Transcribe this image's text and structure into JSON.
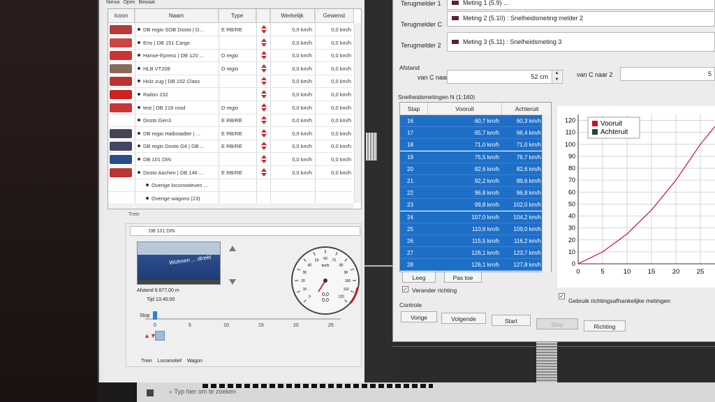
{
  "menu": [
    "Nieuw",
    "Open",
    "Bewaar"
  ],
  "loco_table": {
    "headers": {
      "icon": "Icoon",
      "name": "Naam",
      "type": "Type",
      "actual": "Werkelijk",
      "desired": "Gewenst"
    },
    "rows": [
      {
        "name": "DB regio SOB Dosto | D...",
        "type": "E RB/RE",
        "actual": "0,0 km/h",
        "desired": "0,0 km/h",
        "color": "#b83a3a"
      },
      {
        "name": "Erts | DB 151 Cargo",
        "type": "",
        "actual": "0,0 km/h",
        "desired": "0,0 km/h",
        "color": "#c44"
      },
      {
        "name": "Hanse-Epress | DB 120 ...",
        "type": "D regio",
        "actual": "0,0 km/h",
        "desired": "0,0 km/h",
        "color": "#c33"
      },
      {
        "name": "HLB VT208",
        "type": "D regio",
        "actual": "0,0 km/h",
        "desired": "0,0 km/h",
        "color": "#8a6a5a"
      },
      {
        "name": "Holz zug | DB 152 Class",
        "type": "",
        "actual": "0,0 km/h",
        "desired": "0,0 km/h",
        "color": "#b33"
      },
      {
        "name": "Railon 232",
        "type": "",
        "actual": "0,0 km/h",
        "desired": "0,0 km/h",
        "color": "#c22"
      },
      {
        "name": "test | DB 218 rood",
        "type": "D regio",
        "actual": "0,0 km/h",
        "desired": "0,0 km/h",
        "color": "#c33"
      },
      {
        "name": "Dosto Gen3",
        "type": "E RB/RE",
        "actual": "0,0 km/h",
        "desired": "0,0 km/h",
        "color": ""
      },
      {
        "name": "DB regio Halbstadter | ...",
        "type": "E RB/RE",
        "actual": "0,0 km/h",
        "desired": "0,0 km/h",
        "color": "#445"
      },
      {
        "name": "DB regio Dosto G4 | DB ...",
        "type": "E RB/RE",
        "actual": "0,0 km/h",
        "desired": "0,0 km/h",
        "color": "#446"
      },
      {
        "name": "DB 101 DIN",
        "type": "",
        "actual": "0,0 km/h",
        "desired": "0,0 km/h",
        "color": "#2a4c8c"
      },
      {
        "name": "Dosto Aachen | DB 146 ...",
        "type": "E RB/RE",
        "actual": "0,0 km/h",
        "desired": "0,0 km/h",
        "color": "#b33"
      },
      {
        "name": "Overige locomotieven ...",
        "type": "",
        "actual": "",
        "desired": "",
        "color": ""
      },
      {
        "name": "Overige wagons (23)",
        "type": "",
        "actual": "",
        "desired": "",
        "color": ""
      }
    ]
  },
  "trein": {
    "section_label": "Trein",
    "selected": "DB 101 DIN",
    "photo_text": "Wohnen ... direkt",
    "distance_label": "Afstand",
    "distance_value": "6.677,00 m",
    "time_label": "Tijd",
    "time_value": "13:45:00",
    "stop_label": "Stop",
    "slider_ticks": [
      "0",
      "5",
      "10",
      "15",
      "20",
      "25"
    ],
    "tabs": [
      "Trein",
      "Locomotief",
      "Wagon"
    ],
    "gauge": {
      "unit": "km/h",
      "readout1": "0,0",
      "readout2": "0,0",
      "ticks": [
        "0",
        "10",
        "20",
        "30",
        "40",
        "50",
        "60",
        "70",
        "80",
        "90",
        "100",
        "110",
        "120"
      ]
    }
  },
  "dialog": {
    "terugmelder_1_label": "Terugmelder 1",
    "terugmelder_1_value": "Meting 1 (5.9) ...",
    "terugmelder_c_label": "Terugmelder C",
    "terugmelder_c_value": "Meting 2 (5.10) : Snelheidsmeting melder 2",
    "terugmelder_2_label": "Terugmelder 2",
    "terugmelder_2_value": "Meting 3 (5.11) : Snelheidsmeting 3",
    "afstand_label": "Afstand",
    "van_c_naar_1_label": "van C naar 1",
    "van_c_naar_1_value": "52 cm",
    "van_c_naar_2_label": "van C naar 2",
    "van_c_naar_2_value": "5",
    "speeds_title": "Snelheidsmetingen N (1:160)",
    "speeds_headers": {
      "stap": "Stap",
      "vooruit": "Vooruit",
      "achteruit": "Achteruit"
    },
    "speeds_rows": [
      {
        "stap": "16",
        "vooruit": "60,7 km/h",
        "achteruit": "60,3 km/h"
      },
      {
        "stap": "17",
        "vooruit": "65,7 km/h",
        "achteruit": "66,4 km/h"
      },
      {
        "stap": "18",
        "vooruit": "71,0 km/h",
        "achteruit": "71,0 km/h"
      },
      {
        "stap": "19",
        "vooruit": "75,5 km/h",
        "achteruit": "76,7 km/h"
      },
      {
        "stap": "20",
        "vooruit": "82,6 km/h",
        "achteruit": "82,6 km/h"
      },
      {
        "stap": "21",
        "vooruit": "92,2 km/h",
        "achteruit": "89,6 km/h"
      },
      {
        "stap": "22",
        "vooruit": "96,8 km/h",
        "achteruit": "96,8 km/h"
      },
      {
        "stap": "23",
        "vooruit": "99,8 km/h",
        "achteruit": "102,0 km/h"
      },
      {
        "stap": "24",
        "vooruit": "107,0 km/h",
        "achteruit": "104,2 km/h"
      },
      {
        "stap": "25",
        "vooruit": "110,6 km/h",
        "achteruit": "109,0 km/h"
      },
      {
        "stap": "26",
        "vooruit": "115,5 km/h",
        "achteruit": "116,2 km/h"
      },
      {
        "stap": "27",
        "vooruit": "126,1 km/h",
        "achteruit": "123,7 km/h"
      },
      {
        "stap": "28",
        "vooruit": "126,1 km/h",
        "achteruit": "127,8 km/h"
      }
    ],
    "leeg_button": "Leeg",
    "pas_toe_button": "Pas toe",
    "verander_richting_label": "Verander richting",
    "gebruik_label": "Gebruik richtingsafhankelijke metingen",
    "controle_label": "Controle",
    "vorige_button": "Vorige",
    "volgende_button": "Volgende",
    "start_button": "Start",
    "stop_button": "Stop",
    "richting_button": "Richting"
  },
  "taskbar": {
    "search_placeholder": "Typ hier om te zoeken"
  },
  "colors": {
    "selection": "#1e6fc8",
    "vooruit": "#c8102e",
    "achteruit": "#1d4d2e",
    "gauge_needle": "#c0392b"
  },
  "chart_data": {
    "type": "line",
    "x_ticks": [
      0,
      5,
      10,
      15,
      20,
      25
    ],
    "y_ticks": [
      0,
      10,
      20,
      30,
      40,
      50,
      60,
      70,
      80,
      90,
      100,
      110,
      120
    ],
    "xlim": [
      0,
      28
    ],
    "ylim": [
      0,
      125
    ],
    "legend_position": "top-left",
    "grid": true,
    "series": [
      {
        "name": "Vooruit",
        "color": "#c8102e",
        "x": [
          0,
          5,
          10,
          15,
          20,
          25,
          28
        ],
        "y": [
          0,
          10,
          25,
          45,
          70,
          100,
          115
        ]
      },
      {
        "name": "Achteruit",
        "color": "#1d4d2e",
        "x": [],
        "y": []
      }
    ]
  }
}
